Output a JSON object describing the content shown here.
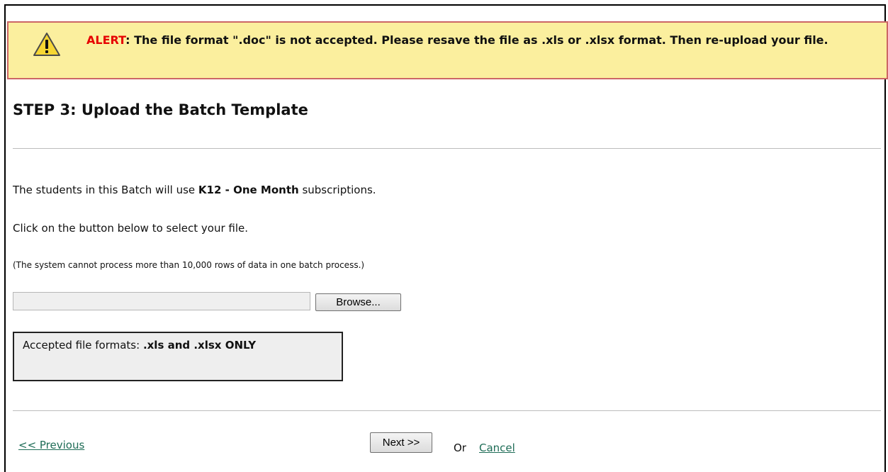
{
  "alert": {
    "label": "ALERT",
    "message": ": The file format \".doc\" is not accepted. Please resave the file as .xls or .xlsx format. Then re-upload your file.",
    "icon": "warning-icon",
    "background": "#fbef9e",
    "border_color": "#cc6666"
  },
  "title": "STEP 3: Upload the Batch Template",
  "subscription_line": {
    "prefix": "The students in this Batch will use ",
    "plan": "K12 - One Month",
    "suffix": " subscriptions."
  },
  "instruction": "Click on the button below to select your file.",
  "note": "(The system cannot process more than 10,000 rows of data in one batch process.)",
  "file_input": {
    "value": "",
    "placeholder": ""
  },
  "browse_label": "Browse...",
  "formats": {
    "prefix": "Accepted file formats: ",
    "bold": ".xls and .xlsx ONLY"
  },
  "nav": {
    "previous_label": "<< Previous",
    "next_label": "Next >>",
    "or_text": "Or",
    "cancel_label": "Cancel",
    "link_color": "#1f6d57"
  }
}
